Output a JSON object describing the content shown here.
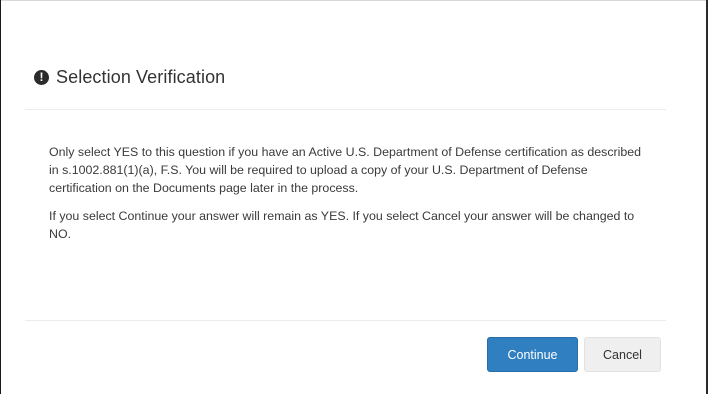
{
  "dialog": {
    "title": "Selection Verification",
    "icon": "exclamation-circle-icon",
    "paragraphs": [
      "Only select YES to this question if you have an Active U.S. Department of Defense certification as described in s.1002.881(1)(a), F.S. You will be required to upload a copy of your U.S. Department of Defense certification on the Documents page later in the process.",
      "If you select Continue your answer will remain as YES. If you select Cancel your answer will be changed to NO."
    ],
    "buttons": {
      "continue_label": "Continue",
      "cancel_label": "Cancel"
    }
  },
  "colors": {
    "primary": "#2f7fc1",
    "default_button": "#efefef"
  }
}
